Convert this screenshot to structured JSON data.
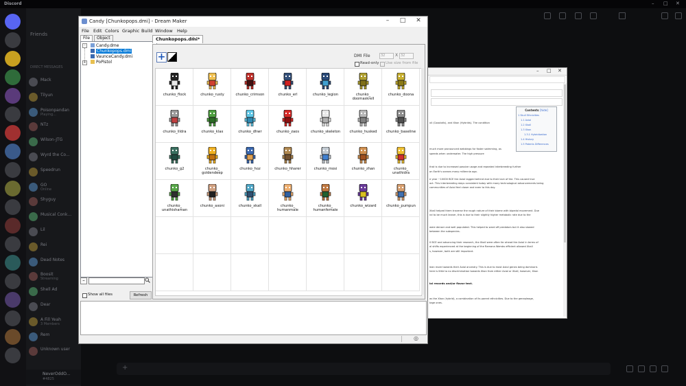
{
  "discord": {
    "app_title": "Discord",
    "friends_label": "Friends",
    "section_label": "DIRECT MESSAGES",
    "dms": [
      {
        "name": "Mack",
        "sub": ""
      },
      {
        "name": "Tilyun",
        "sub": ""
      },
      {
        "name": "Poisonpandan",
        "sub": "Playing..."
      },
      {
        "name": "NTz",
        "sub": ""
      },
      {
        "name": "Wilson-JTG",
        "sub": ""
      },
      {
        "name": "Wyrd the Co...",
        "sub": ""
      },
      {
        "name": "Speedrun",
        "sub": ""
      },
      {
        "name": "GO",
        "sub": "Online"
      },
      {
        "name": "Shyguy",
        "sub": ""
      },
      {
        "name": "Musical Conk...",
        "sub": ""
      },
      {
        "name": "Lil",
        "sub": ""
      },
      {
        "name": "Rei",
        "sub": ""
      },
      {
        "name": "Dead Notes",
        "sub": ""
      },
      {
        "name": "Boosit",
        "sub": "Streaming"
      },
      {
        "name": "Shell Ad",
        "sub": ""
      },
      {
        "name": "Dear",
        "sub": ""
      },
      {
        "name": "A Fill Yeah",
        "sub": "3 Members"
      },
      {
        "name": "Rem",
        "sub": ""
      },
      {
        "name": "Unknown user",
        "sub": ""
      }
    ],
    "user": {
      "name": "NeverOddO...",
      "status": "#4825"
    },
    "compose_plus": "+",
    "toolbar_icons": [
      "phone-icon",
      "video-icon",
      "pin-icon",
      "add-member-icon",
      "search-icon",
      "inbox-icon",
      "help-icon"
    ],
    "window_controls": {
      "min": "–",
      "max": "□",
      "close": "✕"
    }
  },
  "wiki": {
    "window_controls": {
      "min": "–",
      "max": "□",
      "close": "✕"
    },
    "toc_title": "Contents",
    "toc_hide": "[hide]",
    "toc_items": [
      "1  Skull Ethnicities",
      "1.1  Axiol",
      "1.2  Xkall",
      "1.3  Xkon",
      "1.3.1  Hybridization",
      "1.4  History",
      "1.5  Patents Differences"
    ],
    "lines": [
      {
        "text": "xil (Coxolotls), and Xkon (Hybrids). The condition",
        "bold": false
      },
      {
        "text": "much more pronounced webbings for faster swimming, as",
        "bold": false
      },
      {
        "text": "speeds when underwater. The high pressure",
        "bold": false
      },
      {
        "text": "that is due to increased passive usage and repeated interbreeding further",
        "bold": false
      },
      {
        "text": "on Earth's oceans many millennia ago.",
        "bold": false
      },
      {
        "text": "e year ~10000 BCE the Axiol lagged behind due to their lack of the. This caused true",
        "bold": false
      },
      {
        "text": "act. This interbreeding stays consistent today with many technological advancements being",
        "bold": false
      },
      {
        "text": "communities of Axiol feel closer and even to this day.",
        "bold": false
      },
      {
        "text": "Xkall helped them traverse the rough nature of their biome with bipedal movement. Due",
        "bold": false
      },
      {
        "text": "nd to be much leaner, this is due to their slightly higher metabolic rate due to the",
        "bold": false
      },
      {
        "text": "were denser and well populated. This helped to ward off predators but it also slowed",
        "bold": false
      },
      {
        "text": "between the subspecies.",
        "bold": false
      },
      {
        "text": "0 BCE and advancing their research, the Xkall were often far ahead the Axiol in terms of",
        "bold": false
      },
      {
        "text": "al shifts experienced at the beginning of the Ramana Wembs efficient allowed Xkall",
        "bold": false
      },
      {
        "text": "s, however, both are still important.",
        "bold": false
      },
      {
        "text": "lean more towards their Axiol ancestry. This is due to most Axiol genes being dominant.",
        "bold": false
      },
      {
        "text": "here is little to no discrimination towards Xkon from either Axiol or Xkall, however, Xkon",
        "bold": false
      },
      {
        "text": "ial records and/or flavor text.",
        "bold": true
      },
      {
        "text": "as the Xkon (hybrid), a combination of its parent ethnicities. Due to the genepleage,",
        "bold": false
      },
      {
        "text": "tage ones.",
        "bold": false
      }
    ]
  },
  "dm": {
    "title": "Candy [Chunkopops.dmi] - Dream Maker",
    "window_controls": {
      "min": "–",
      "max": "□",
      "close": "✕"
    },
    "menu": [
      "File",
      "Edit",
      "Colors",
      "Graphic",
      "Build",
      "Window",
      "Help"
    ],
    "left_tabs": [
      "File",
      "Object"
    ],
    "tree": [
      {
        "label": "Candy.dme",
        "selected": false,
        "icon": "dme-file-icon",
        "toggle": ""
      },
      {
        "label": "Chunkopops.dmi",
        "selected": true,
        "icon": "dmi-file-icon",
        "toggle": ""
      },
      {
        "label": "VaunceCandy.dmi",
        "selected": false,
        "icon": "dmi-file-icon",
        "toggle": ""
      },
      {
        "label": "PoPistol",
        "selected": false,
        "icon": "folder-icon",
        "toggle": "+"
      }
    ],
    "tree_root_toggle": "–",
    "search_minus": "–",
    "show_all_files": "Show all files",
    "refresh": "Refresh",
    "file_tab": "Chunkopops.dmi*",
    "file_tab_close": "x",
    "dmi_file_label": "DMI File",
    "dmi_width": "32",
    "dmi_x": "X",
    "dmi_height": "32",
    "read_only_label": "Read-only",
    "use_size_label": "Use size from file",
    "icons": [
      {
        "name": "chunko_flock",
        "color": "#222222",
        "accent": "#e8e8e8"
      },
      {
        "name": "chunko_rusty",
        "color": "#f0c050",
        "accent": "#d04030"
      },
      {
        "name": "chunko_crimson",
        "color": "#c0302a",
        "accent": "#401010"
      },
      {
        "name": "chunko_erl",
        "color": "#34507a",
        "accent": "#d02020"
      },
      {
        "name": "chunko_legion",
        "color": "#2a4a78",
        "accent": "#40a0d0"
      },
      {
        "name": "chunko_\ndoomaskrell",
        "color": "#b0a030",
        "accent": "#807018"
      },
      {
        "name": "chunko_doona",
        "color": "#c8b030",
        "accent": "#8a7a18"
      },
      {
        "name": "chunko_lildra",
        "color": "#9a9a9a",
        "accent": "#c04040"
      },
      {
        "name": "chunko_klax",
        "color": "#4ea040",
        "accent": "#2c6a26"
      },
      {
        "name": "chunko_dhwr",
        "color": "#60c8e8",
        "accent": "#3088b0"
      },
      {
        "name": "chunko_zaos",
        "color": "#d82a28",
        "accent": "#8a1010"
      },
      {
        "name": "chunko_skeleton",
        "color": "#e8e8e8",
        "accent": "#b0b0b0"
      },
      {
        "name": "chunko_husked",
        "color": "#b8b8b8",
        "accent": "#808080"
      },
      {
        "name": "chunko_baseline",
        "color": "#909090",
        "accent": "#505050"
      },
      {
        "name": "chunko_g2",
        "color": "#3a7060",
        "accent": "#204a40"
      },
      {
        "name": "chunko_\ngoldendeep",
        "color": "#f0b020",
        "accent": "#c07010"
      },
      {
        "name": "chunko_hoz",
        "color": "#3a68b0",
        "accent": "#e0a050"
      },
      {
        "name": "chunko_hharer",
        "color": "#b08850",
        "accent": "#705030"
      },
      {
        "name": "chunko_mosi",
        "color": "#c0c8d0",
        "accent": "#4080d0"
      },
      {
        "name": "chunko_zhan",
        "color": "#d09050",
        "accent": "#a05020"
      },
      {
        "name": "chunko_\nunathidra",
        "color": "#f0c030",
        "accent": "#d03030"
      },
      {
        "name": "chunko_\nunathishaman",
        "color": "#58a848",
        "accent": "#303030"
      },
      {
        "name": "chunko_axoni",
        "color": "#d0a080",
        "accent": "#202020"
      },
      {
        "name": "chunko_xkall",
        "color": "#50a8c8",
        "accent": "#305070"
      },
      {
        "name": "chunko_\nhumanmale",
        "color": "#f0b070",
        "accent": "#3060a0"
      },
      {
        "name": "chunko_\nhumanfemale",
        "color": "#c07840",
        "accent": "#206030"
      },
      {
        "name": "chunko_wizard",
        "color": "#6a3a9a",
        "accent": "#d8c020"
      },
      {
        "name": "chunko_pumpun",
        "color": "#d8a070",
        "accent": "#4070b0"
      }
    ],
    "status_icon": "◎"
  }
}
